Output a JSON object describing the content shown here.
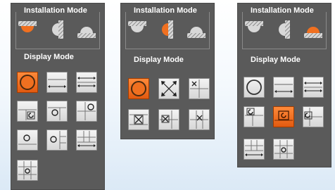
{
  "labels": {
    "installation_mode": "Installation Mode",
    "display_mode": "Display Mode"
  },
  "colors": {
    "panel": "#5a5a5a",
    "selected": "#f0661a",
    "button": "#e2e2e2"
  },
  "panels": [
    {
      "selected_installation": "ceiling",
      "display_modes": [
        "fisheye",
        "panorama",
        "double-panorama",
        "fisheye-3ptz",
        "panorama-3ptz",
        "fisheye-8ptz",
        "fisheye-4ptz",
        "panorama-6ptz",
        "panorama-8ptz",
        "fisheye-quad-ptz"
      ],
      "selected_display": "fisheye"
    },
    {
      "selected_installation": "wall",
      "display_modes": [
        "fisheye",
        "ptz-expand",
        "quad-ptz",
        "fisheye-4ptz",
        "quad-ptz-alt",
        "split-ptz"
      ],
      "selected_display": "fisheye"
    },
    {
      "selected_installation": "floor",
      "display_modes": [
        "fisheye",
        "panorama",
        "double-panorama",
        "fisheye-3ptz",
        "fisheye-ptz",
        "panorama-ptz",
        "panorama-split",
        "fisheye-ptz-grid"
      ],
      "selected_display": "fisheye-ptz"
    }
  ]
}
